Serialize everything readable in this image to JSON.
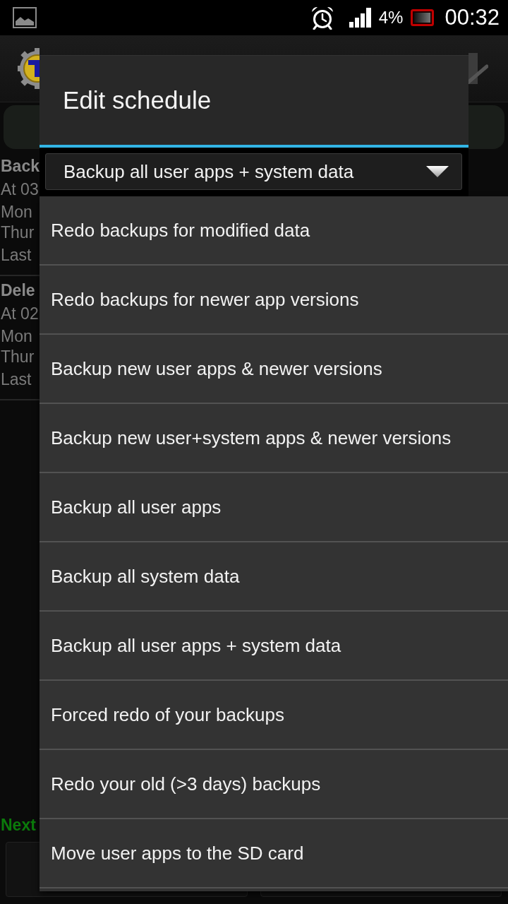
{
  "status_bar": {
    "battery_text": "4%",
    "time": "00:32"
  },
  "app": {
    "schedules": [
      {
        "title": "Back",
        "time": "At 03",
        "days": [
          "Mon",
          "Thur"
        ],
        "last": "Last"
      },
      {
        "title": "Dele",
        "time": "At 02",
        "days": [
          "Mon",
          "Thur"
        ],
        "last": "Last"
      }
    ],
    "footer_label": "Next"
  },
  "dialog": {
    "title": "Edit schedule",
    "spinner": {
      "value": "Backup all user apps + system data"
    },
    "options": [
      "Redo backups for modified data",
      "Redo backups for newer app versions",
      "Backup new user apps & newer versions",
      "Backup new user+system apps & newer versions",
      "Backup all user apps",
      "Backup all system data",
      "Backup all user apps + system data",
      "Forced redo of your backups",
      "Redo your old (>3 days) backups",
      "Move user apps to the SD card"
    ]
  }
}
